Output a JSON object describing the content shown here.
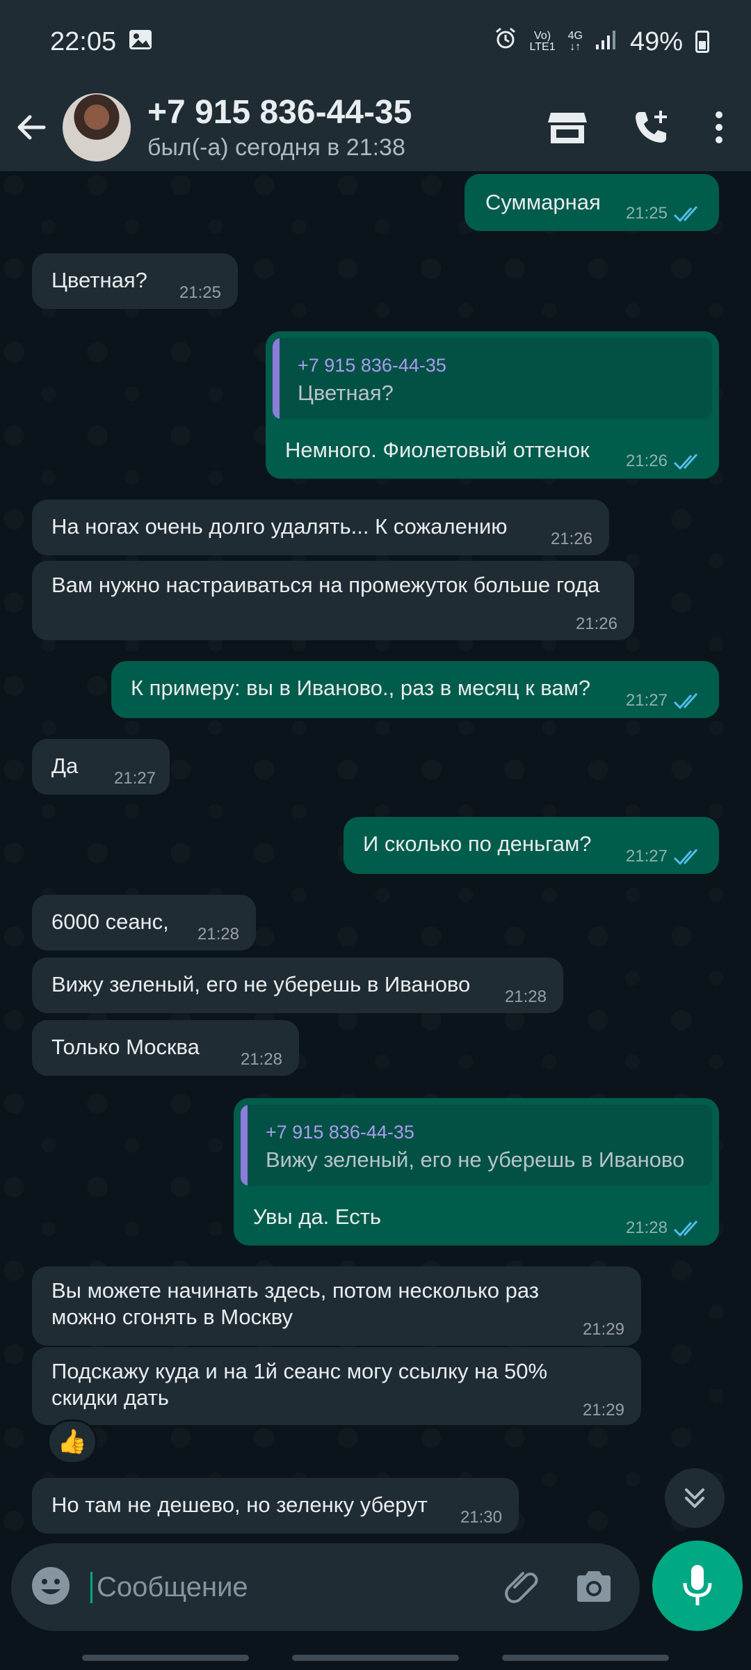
{
  "status_bar": {
    "time": "22:05",
    "network_label_top": "Vo)",
    "network_label_bottom": "LTE1",
    "network_type": "4G",
    "battery": "49%",
    "icons": [
      "gallery-icon",
      "alarm-icon",
      "signal-icon",
      "battery-icon"
    ]
  },
  "header": {
    "contact_name": "+7 915 836-44-35",
    "contact_status": "был(-а) сегодня в 21:38",
    "icons": [
      "back-arrow-icon",
      "avatar",
      "shop-icon",
      "add-call-icon",
      "more-vert-icon"
    ]
  },
  "messages": [
    {
      "dir": "out",
      "text": "Суммарная",
      "time": "21:25",
      "status": "read"
    },
    {
      "dir": "in",
      "text": "Цветная?",
      "time": "21:25"
    },
    {
      "dir": "out",
      "quote_name": "+7 915 836-44-35",
      "quote_text": "Цветная?",
      "text": "Немного. Фиолетовый оттенок",
      "time": "21:26",
      "status": "read"
    },
    {
      "dir": "in",
      "text": "На ногах очень долго удалять... К сожалению",
      "time": "21:26"
    },
    {
      "dir": "in",
      "text": "Вам нужно настраиваться на промежуток больше года",
      "time": "21:26"
    },
    {
      "dir": "out",
      "text": "К примеру: вы в Иваново., раз в месяц к вам?",
      "time": "21:27",
      "status": "read"
    },
    {
      "dir": "in",
      "text": "Да",
      "time": "21:27"
    },
    {
      "dir": "out",
      "text": "И сколько по деньгам?",
      "time": "21:27",
      "status": "read"
    },
    {
      "dir": "in",
      "text": "6000 сеанс,",
      "time": "21:28"
    },
    {
      "dir": "in",
      "text": "Вижу зеленый, его не уберешь в Иваново",
      "time": "21:28"
    },
    {
      "dir": "in",
      "text": "Только Москва",
      "time": "21:28"
    },
    {
      "dir": "out",
      "quote_name": "+7 915 836-44-35",
      "quote_text": "Вижу зеленый, его не уберешь в Иваново",
      "text": "Увы да. Есть",
      "time": "21:28",
      "status": "read"
    },
    {
      "dir": "in",
      "text_line1": "Вы можете начинать здесь, потом несколько раз",
      "text_line2": "можно сгонять в Москву",
      "time": "21:29"
    },
    {
      "dir": "in",
      "text_line1": "Подскажу куда и на 1й сеанс могу ссылку на 50%",
      "text_line2": "скидки дать",
      "time": "21:29",
      "reaction": "👍"
    },
    {
      "dir": "in",
      "text": "Но там не дешево, но зеленку уберут",
      "time": "21:30"
    }
  ],
  "input": {
    "placeholder": "Сообщение",
    "value": ""
  },
  "colors": {
    "background": "#0b141a",
    "header": "#1f2c34",
    "incoming_bubble": "#202c33",
    "outgoing_bubble": "#005c4b",
    "accent": "#00a884",
    "read_ticks": "#53bdeb",
    "quote_bar": "#8e7cdb"
  }
}
